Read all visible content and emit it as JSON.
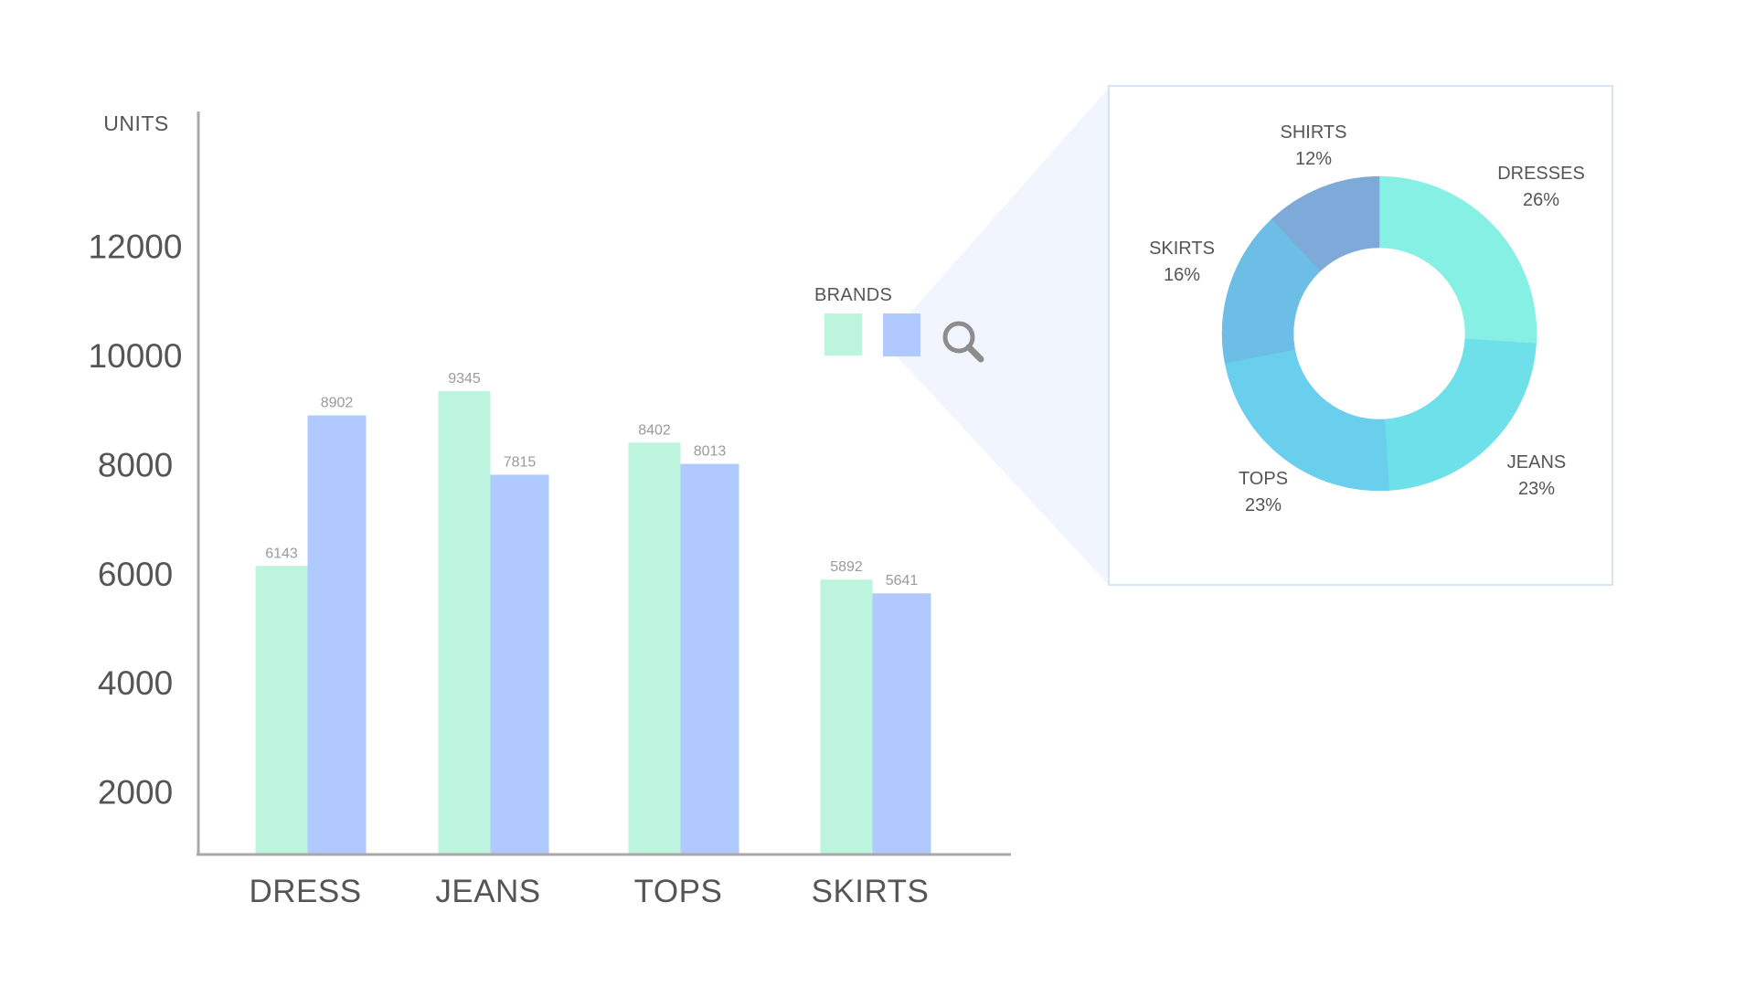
{
  "colors": {
    "series_a": "#bdf4de",
    "series_b": "#b0caff",
    "axis": "#a8a8a8",
    "zoom_fill": "#f0f5fe",
    "zoom_border": "#c8dcf4",
    "magnifier": "#8d8d8d"
  },
  "icons": {
    "legend_action": "magnifier-icon"
  },
  "chart_data": [
    {
      "type": "bar",
      "ylabel": "UNITS",
      "ylim": [
        0,
        12000
      ],
      "yticks": [
        2000,
        4000,
        6000,
        8000,
        10000,
        12000
      ],
      "categories": [
        "DRESS",
        "JEANS",
        "TOPS",
        "SKIRTS"
      ],
      "legend": {
        "title": "BRANDS",
        "placement": "right of plot"
      },
      "series": [
        {
          "values": [
            6143,
            9345,
            8402,
            5892
          ],
          "color": "#bdf4de"
        },
        {
          "values": [
            8902,
            7815,
            8013,
            5641
          ],
          "color": "#b0caff"
        }
      ],
      "grid": false
    },
    {
      "type": "pie",
      "donut": true,
      "slices": [
        {
          "label": "DRESSES",
          "pct": "26%",
          "value": 26,
          "color": "#86f0e5"
        },
        {
          "label": "JEANS",
          "pct": "23%",
          "value": 23,
          "color": "#6de0e9"
        },
        {
          "label": "TOPS",
          "pct": "23%",
          "value": 23,
          "color": "#6acfec"
        },
        {
          "label": "SKIRTS",
          "pct": "16%",
          "value": 16,
          "color": "#6cbee6"
        },
        {
          "label": "SHIRTS",
          "pct": "12%",
          "value": 12,
          "color": "#7daad9"
        }
      ]
    }
  ]
}
